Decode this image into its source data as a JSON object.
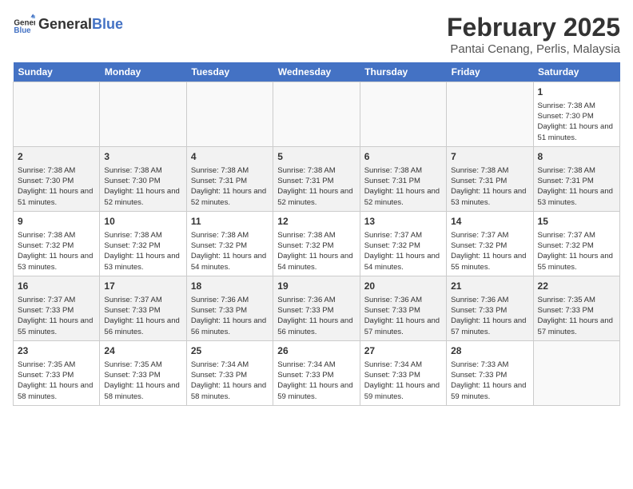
{
  "header": {
    "logo_general": "General",
    "logo_blue": "Blue",
    "title": "February 2025",
    "subtitle": "Pantai Cenang, Perlis, Malaysia"
  },
  "weekdays": [
    "Sunday",
    "Monday",
    "Tuesday",
    "Wednesday",
    "Thursday",
    "Friday",
    "Saturday"
  ],
  "weeks": [
    [
      {
        "day": "",
        "info": ""
      },
      {
        "day": "",
        "info": ""
      },
      {
        "day": "",
        "info": ""
      },
      {
        "day": "",
        "info": ""
      },
      {
        "day": "",
        "info": ""
      },
      {
        "day": "",
        "info": ""
      },
      {
        "day": "1",
        "info": "Sunrise: 7:38 AM\nSunset: 7:30 PM\nDaylight: 11 hours and 51 minutes."
      }
    ],
    [
      {
        "day": "2",
        "info": "Sunrise: 7:38 AM\nSunset: 7:30 PM\nDaylight: 11 hours and 51 minutes."
      },
      {
        "day": "3",
        "info": "Sunrise: 7:38 AM\nSunset: 7:30 PM\nDaylight: 11 hours and 52 minutes."
      },
      {
        "day": "4",
        "info": "Sunrise: 7:38 AM\nSunset: 7:31 PM\nDaylight: 11 hours and 52 minutes."
      },
      {
        "day": "5",
        "info": "Sunrise: 7:38 AM\nSunset: 7:31 PM\nDaylight: 11 hours and 52 minutes."
      },
      {
        "day": "6",
        "info": "Sunrise: 7:38 AM\nSunset: 7:31 PM\nDaylight: 11 hours and 52 minutes."
      },
      {
        "day": "7",
        "info": "Sunrise: 7:38 AM\nSunset: 7:31 PM\nDaylight: 11 hours and 53 minutes."
      },
      {
        "day": "8",
        "info": "Sunrise: 7:38 AM\nSunset: 7:31 PM\nDaylight: 11 hours and 53 minutes."
      }
    ],
    [
      {
        "day": "9",
        "info": "Sunrise: 7:38 AM\nSunset: 7:32 PM\nDaylight: 11 hours and 53 minutes."
      },
      {
        "day": "10",
        "info": "Sunrise: 7:38 AM\nSunset: 7:32 PM\nDaylight: 11 hours and 53 minutes."
      },
      {
        "day": "11",
        "info": "Sunrise: 7:38 AM\nSunset: 7:32 PM\nDaylight: 11 hours and 54 minutes."
      },
      {
        "day": "12",
        "info": "Sunrise: 7:38 AM\nSunset: 7:32 PM\nDaylight: 11 hours and 54 minutes."
      },
      {
        "day": "13",
        "info": "Sunrise: 7:37 AM\nSunset: 7:32 PM\nDaylight: 11 hours and 54 minutes."
      },
      {
        "day": "14",
        "info": "Sunrise: 7:37 AM\nSunset: 7:32 PM\nDaylight: 11 hours and 55 minutes."
      },
      {
        "day": "15",
        "info": "Sunrise: 7:37 AM\nSunset: 7:32 PM\nDaylight: 11 hours and 55 minutes."
      }
    ],
    [
      {
        "day": "16",
        "info": "Sunrise: 7:37 AM\nSunset: 7:33 PM\nDaylight: 11 hours and 55 minutes."
      },
      {
        "day": "17",
        "info": "Sunrise: 7:37 AM\nSunset: 7:33 PM\nDaylight: 11 hours and 56 minutes."
      },
      {
        "day": "18",
        "info": "Sunrise: 7:36 AM\nSunset: 7:33 PM\nDaylight: 11 hours and 56 minutes."
      },
      {
        "day": "19",
        "info": "Sunrise: 7:36 AM\nSunset: 7:33 PM\nDaylight: 11 hours and 56 minutes."
      },
      {
        "day": "20",
        "info": "Sunrise: 7:36 AM\nSunset: 7:33 PM\nDaylight: 11 hours and 57 minutes."
      },
      {
        "day": "21",
        "info": "Sunrise: 7:36 AM\nSunset: 7:33 PM\nDaylight: 11 hours and 57 minutes."
      },
      {
        "day": "22",
        "info": "Sunrise: 7:35 AM\nSunset: 7:33 PM\nDaylight: 11 hours and 57 minutes."
      }
    ],
    [
      {
        "day": "23",
        "info": "Sunrise: 7:35 AM\nSunset: 7:33 PM\nDaylight: 11 hours and 58 minutes."
      },
      {
        "day": "24",
        "info": "Sunrise: 7:35 AM\nSunset: 7:33 PM\nDaylight: 11 hours and 58 minutes."
      },
      {
        "day": "25",
        "info": "Sunrise: 7:34 AM\nSunset: 7:33 PM\nDaylight: 11 hours and 58 minutes."
      },
      {
        "day": "26",
        "info": "Sunrise: 7:34 AM\nSunset: 7:33 PM\nDaylight: 11 hours and 59 minutes."
      },
      {
        "day": "27",
        "info": "Sunrise: 7:34 AM\nSunset: 7:33 PM\nDaylight: 11 hours and 59 minutes."
      },
      {
        "day": "28",
        "info": "Sunrise: 7:33 AM\nSunset: 7:33 PM\nDaylight: 11 hours and 59 minutes."
      },
      {
        "day": "",
        "info": ""
      }
    ]
  ]
}
